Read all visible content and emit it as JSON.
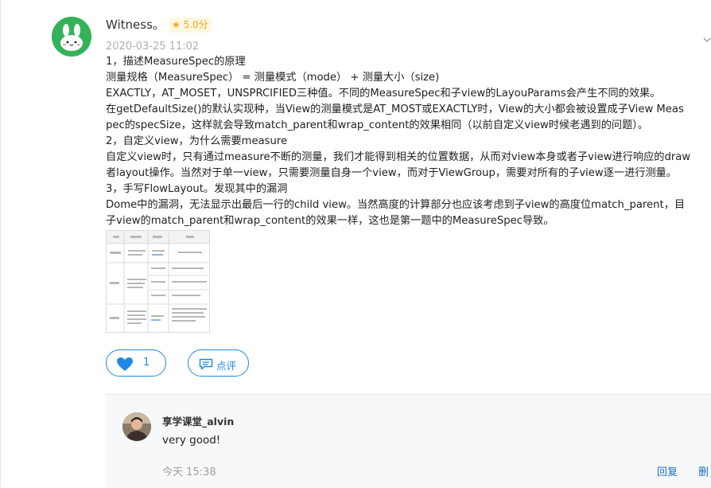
{
  "comment": {
    "username": "Witness。",
    "rating": "5.0分",
    "timestamp": "2020-03-25 11:02",
    "lines": [
      "1，描述MeasureSpec的原理",
      "测量规格（MeasureSpec） = 测量模式（mode） + 测量大小（size)",
      "EXACTLY，AT_MOSET，UNSPRCIFIED三种值。不同的MeasureSpec和子view的LayouParams会产生不同的效果。",
      "在getDefaultSize()的默认实现种，当View的测量模式是AT_MOST或EXACTLY时，View的大小都会被设置成子View Meas",
      "pec的specSize，这样就会导致match_parent和wrap_content的效果相同（以前自定义view时候老遇到的问题）。",
      "2，自定义view，为什么需要measure",
      "自定义view时，只有通过measure不断的测量，我们才能得到相关的位置数据，从而对view本身或者子view进行响应的draw",
      "者layout操作。当然对于单一view，只需要测量自身一个view，而对于ViewGroup，需要对所有的子view逐一进行测量。",
      "3，手写FlowLayout。发现其中的漏洞",
      "Dome中的漏洞，无法显示出最后一行的child view。当然高度的计算部分也应该考虑到子view的高度位match_parent，目",
      "子view的match_parent和wrap_content的效果一样，这也是第一题中的MeasureSpec导致。"
    ],
    "like_count": "1",
    "comment_label": "点评"
  },
  "reply": {
    "author": "享学课堂_alvin",
    "text": "very good!",
    "time": "今天 15:38",
    "reply_label": "回复",
    "delete_label": "删"
  },
  "icons": {
    "avatar": "bunny-avatar-icon",
    "rating": "star-icon",
    "like": "heart-icon",
    "comment": "comment-icon",
    "expand": "chevron-down-icon"
  },
  "colors": {
    "accent": "#1e88e5",
    "avatar_bg": "#34b25a",
    "rating_star": "#f5a623",
    "reply_bg": "#f7f8fa"
  }
}
